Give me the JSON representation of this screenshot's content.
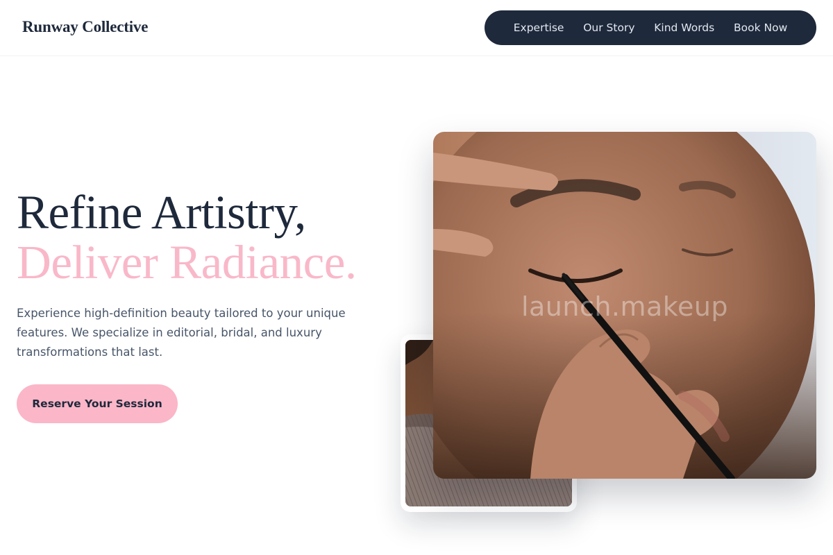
{
  "brand": {
    "name": "Runway Collective"
  },
  "nav": {
    "items": [
      {
        "label": "Expertise"
      },
      {
        "label": "Our Story"
      },
      {
        "label": "Kind Words"
      },
      {
        "label": "Book Now"
      }
    ]
  },
  "hero": {
    "title_line1": "Refine Artistry,",
    "title_line2": "Deliver Radiance.",
    "description": "Experience high-definition beauty tailored to your unique features. We specialize in editorial, bridal, and luxury transformations that last.",
    "cta_label": "Reserve Your Session"
  },
  "images": {
    "main_watermark": "launch.makeup",
    "main_alt": "Makeup artist applying eyeliner with a brush",
    "secondary_alt": "Close-up of model skin and textured fabric"
  },
  "colors": {
    "navy": "#1e293b",
    "pink": "#f9b8c9",
    "cta_pink": "#fbb6c8",
    "body_text": "#475569"
  }
}
